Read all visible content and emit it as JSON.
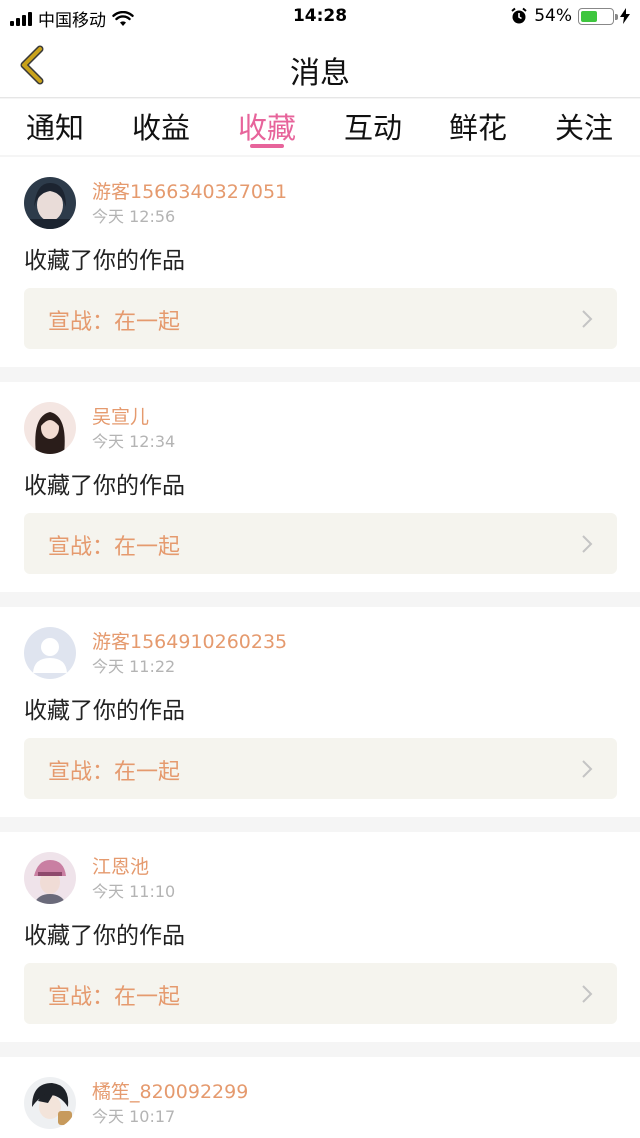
{
  "status_bar": {
    "carrier": "中国移动",
    "time": "14:28",
    "battery_percent": "54%",
    "battery_level": 0.54,
    "icons": [
      "signal-icon",
      "wifi-icon",
      "alarm-icon",
      "battery-icon",
      "charging-icon"
    ]
  },
  "nav": {
    "title": "消息",
    "back_icon": "chevron-left-icon",
    "back_color": "#c9a21a"
  },
  "tabs": [
    {
      "label": "通知",
      "active": false
    },
    {
      "label": "收益",
      "active": false
    },
    {
      "label": "收藏",
      "active": true
    },
    {
      "label": "互动",
      "active": false
    },
    {
      "label": "鲜花",
      "active": false
    },
    {
      "label": "关注",
      "active": false
    }
  ],
  "colors": {
    "accent": "#e7649b",
    "username": "#e59a6e",
    "link_bg": "#f5f4ee",
    "page_bg": "#f5f5f5"
  },
  "messages": [
    {
      "username": "游客1566340327051",
      "time": "今天 12:56",
      "action": "收藏了你的作品",
      "link": "宣战：在一起",
      "avatar": "avatar-girl-dark"
    },
    {
      "username": "吴宣儿",
      "time": "今天 12:34",
      "action": "收藏了你的作品",
      "link": "宣战：在一起",
      "avatar": "avatar-girl-longhair"
    },
    {
      "username": "游客1564910260235",
      "time": "今天 11:22",
      "action": "收藏了你的作品",
      "link": "宣战：在一起",
      "avatar": "avatar-default-person"
    },
    {
      "username": "江恩池",
      "time": "今天 11:10",
      "action": "收藏了你的作品",
      "link": "宣战：在一起",
      "avatar": "avatar-pink-hat"
    },
    {
      "username": "橘笙_820092299",
      "time": "今天 10:17",
      "action": "",
      "link": "",
      "avatar": "avatar-anime-boy"
    }
  ]
}
